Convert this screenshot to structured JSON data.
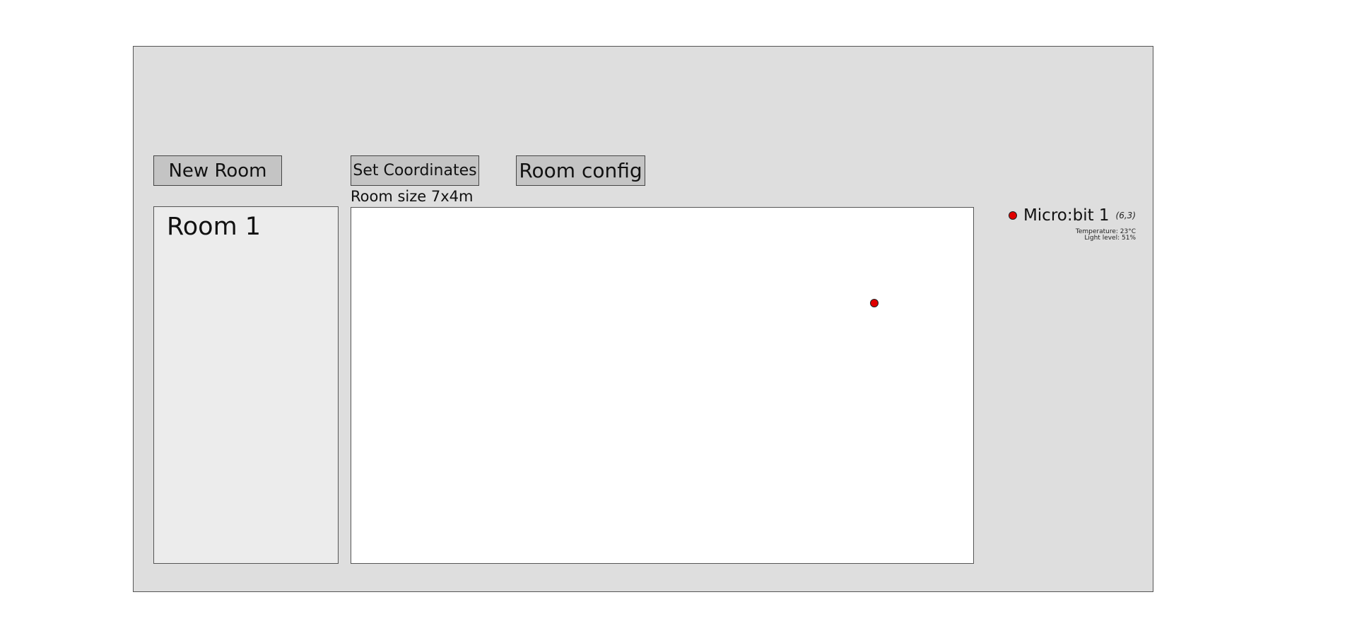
{
  "toolbar": {
    "new_room_label": "New Room",
    "set_coordinates_label": "Set Coordinates",
    "room_config_label": "Room config"
  },
  "rooms": [
    {
      "name": "Room 1"
    }
  ],
  "room": {
    "size_label": "Room size 7x4m"
  },
  "devices": [
    {
      "name": "Micro:bit 1",
      "coords": "(6,3)",
      "status_color": "#e00000",
      "temperature_label": "Temperature: 23°C",
      "light_label": "Light level:  51%"
    }
  ],
  "colors": {
    "frame_background": "#dedede",
    "button_background": "#c4c4c4",
    "room_list_background": "#ececec",
    "canvas_background": "#ffffff",
    "device_marker": "#e00000"
  }
}
